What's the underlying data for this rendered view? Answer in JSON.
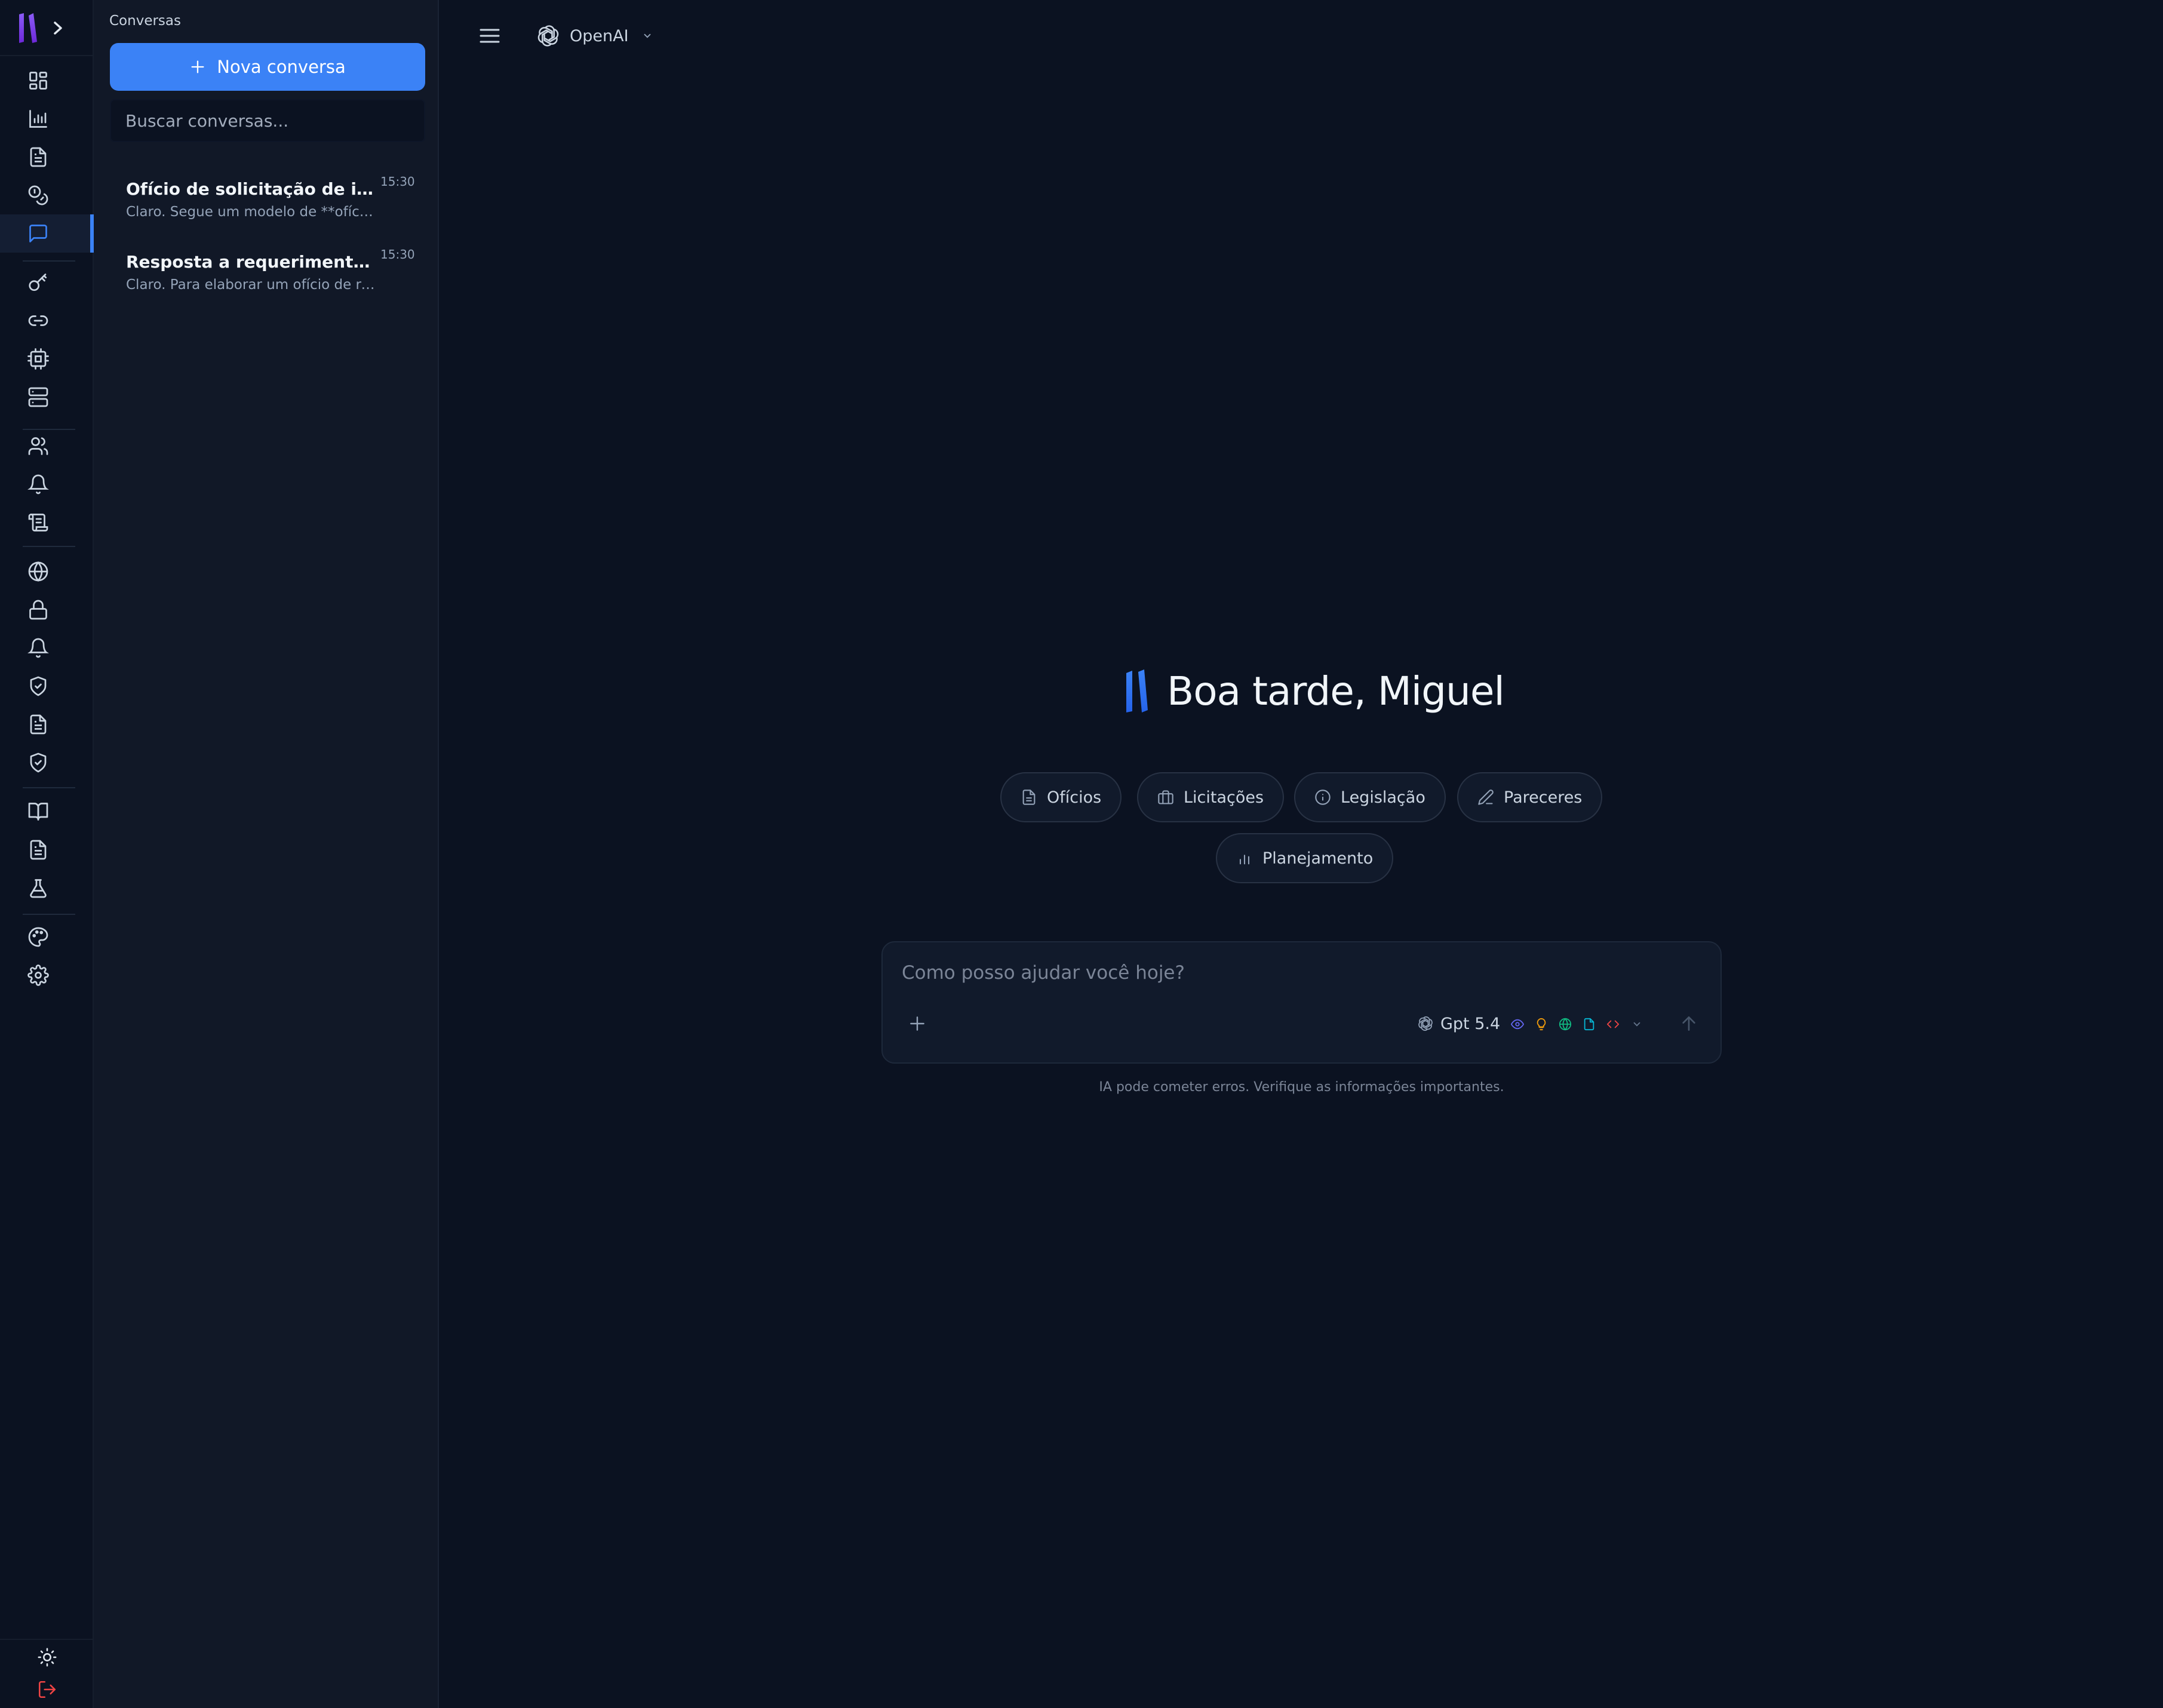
{
  "rail": {
    "logo": "app-logo",
    "expand_icon": "chevron-right-icon",
    "items": [
      {
        "icon": "dashboard-icon",
        "active": false
      },
      {
        "icon": "bar-chart-icon",
        "active": false
      },
      {
        "icon": "document-icon",
        "active": false
      },
      {
        "icon": "coins-icon",
        "active": false
      },
      {
        "icon": "chat-icon",
        "active": true
      },
      {
        "icon": "key-icon",
        "active": false
      },
      {
        "icon": "link-icon",
        "active": false
      },
      {
        "icon": "cpu-icon",
        "active": false
      },
      {
        "icon": "server-icon",
        "active": false
      },
      {
        "icon": "users-icon",
        "active": false
      },
      {
        "icon": "bell-icon",
        "active": false
      },
      {
        "icon": "scroll-icon",
        "active": false
      },
      {
        "icon": "globe-icon",
        "active": false
      },
      {
        "icon": "lock-icon",
        "active": false
      },
      {
        "icon": "bell-icon",
        "active": false
      },
      {
        "icon": "shield-check-icon",
        "active": false
      },
      {
        "icon": "document-icon",
        "active": false
      },
      {
        "icon": "shield-check-icon",
        "active": false
      },
      {
        "icon": "book-open-icon",
        "active": false
      },
      {
        "icon": "document-icon",
        "active": false
      },
      {
        "icon": "flask-icon",
        "active": false
      },
      {
        "icon": "palette-icon",
        "active": false
      },
      {
        "icon": "gear-icon",
        "active": false
      }
    ],
    "bottom": {
      "theme_icon": "sun-icon",
      "logout_icon": "logout-icon"
    }
  },
  "sidebar": {
    "title": "Conversas",
    "new_button_label": "Nova conversa",
    "search_placeholder": "Buscar conversas...",
    "conversations": [
      {
        "title": "Ofício de solicitação de informações",
        "time": "15:30",
        "preview": "Claro. Segue um modelo de **ofício de solicitação"
      },
      {
        "title": "Resposta a requerimento de informação",
        "time": "15:30",
        "preview": "Claro. Para elaborar um ofício de resposta"
      }
    ]
  },
  "header": {
    "menu_icon": "hamburger-icon",
    "provider": "OpenAI",
    "provider_icon": "openai-icon"
  },
  "main": {
    "greeting": "Boa tarde, Miguel",
    "chips": [
      {
        "label": "Ofícios",
        "icon": "document-icon"
      },
      {
        "label": "Licitações",
        "icon": "briefcase-icon"
      },
      {
        "label": "Legislação",
        "icon": "info-icon"
      },
      {
        "label": "Pareceres",
        "icon": "pencil-icon"
      },
      {
        "label": "Planejamento",
        "icon": "bar-chart-icon"
      }
    ],
    "composer": {
      "placeholder": "Como posso ajudar você hoje?",
      "model": "Gpt 5.4",
      "capabilities": [
        {
          "icon": "eye-icon",
          "color": "#6366f1"
        },
        {
          "icon": "lightbulb-icon",
          "color": "#f59e0b"
        },
        {
          "icon": "globe-icon",
          "color": "#10b981"
        },
        {
          "icon": "file-icon",
          "color": "#06b6d4"
        },
        {
          "icon": "code-icon",
          "color": "#ef4444"
        }
      ]
    },
    "disclaimer": "IA pode cometer erros. Verifique as informações importantes."
  },
  "colors": {
    "accent": "#3b82f6",
    "background": "#0b1221",
    "panel": "#111827",
    "logout": "#ef4444"
  }
}
